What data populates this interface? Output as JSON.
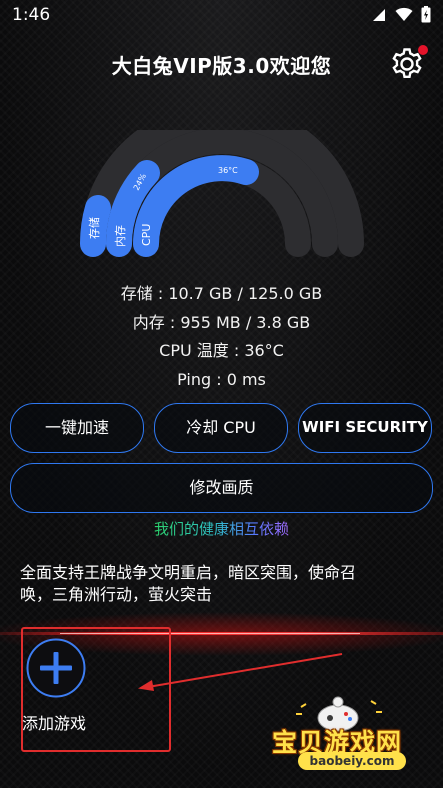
{
  "status_bar": {
    "time": "1:46"
  },
  "header": {
    "title": "大白兔VIP版3.0欢迎您"
  },
  "gauge": {
    "labels": {
      "storage": "存储",
      "memory": "内存",
      "cpu": "CPU"
    },
    "storage_percent_label": "",
    "memory_percent_label": "24%",
    "cpu_temp_label": "36°C",
    "colors": {
      "track": "#2d2d30",
      "fill": "#3d7df2"
    }
  },
  "stats": {
    "storage": "存储 : 10.7 GB / 125.0 GB",
    "memory": "内存 : 955 MB / 3.8 GB",
    "cpu_temp": "CPU 温度 : 36°C",
    "ping": "Ping : 0 ms"
  },
  "buttons": {
    "boost": "一键加速",
    "cool_cpu": "冷却 CPU",
    "wifi_security": "WIFI SECURITY",
    "modify_quality": "修改画质"
  },
  "slogan": "我们的健康相互依赖",
  "notice": "全面支持王牌战争文明重启，暗区突围，使命召唤，三角洲行动，萤火突击",
  "add_game": {
    "label": "添加游戏"
  },
  "watermark": {
    "text": "宝贝游戏网",
    "url": "baobeiy.com"
  },
  "colors": {
    "accent": "#2f78f0",
    "highlight_box": "#e02d2d",
    "notification_dot": "#e5132a"
  }
}
